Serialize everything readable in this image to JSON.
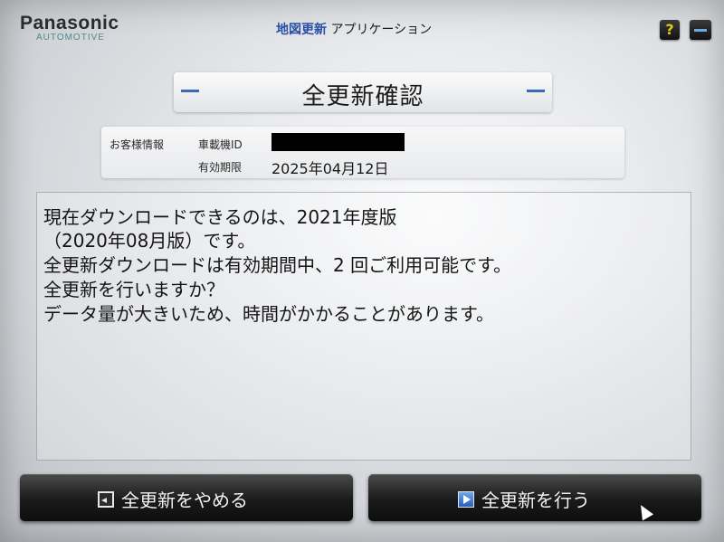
{
  "header": {
    "brand": "Panasonic",
    "brand_sub": "AUTOMOTIVE",
    "app_title_highlight": "地図更新",
    "app_title_rest": " アプリケーション",
    "help_label": "?"
  },
  "title": {
    "text": "全更新確認"
  },
  "info": {
    "customer_info_label": "お客様情報",
    "vehicle_id_label": "車載機ID",
    "expiry_label": "有効期限",
    "expiry_value": "2025年04月12日"
  },
  "message": {
    "lines": [
      "現在ダウンロードできるのは、2021年度版",
      "（2020年08月版）です。",
      "全更新ダウンロードは有効期間中、2 回ご利用可能です。",
      "全更新を行いますか？",
      "データ量が大きいため、時間がかかることがあります。"
    ]
  },
  "buttons": {
    "cancel_label": "全更新をやめる",
    "confirm_label": "全更新を行う"
  },
  "colors": {
    "accent_blue": "#3c68b8",
    "button_dark": "#1a1a1a",
    "help_yellow": "#e8c41a"
  }
}
